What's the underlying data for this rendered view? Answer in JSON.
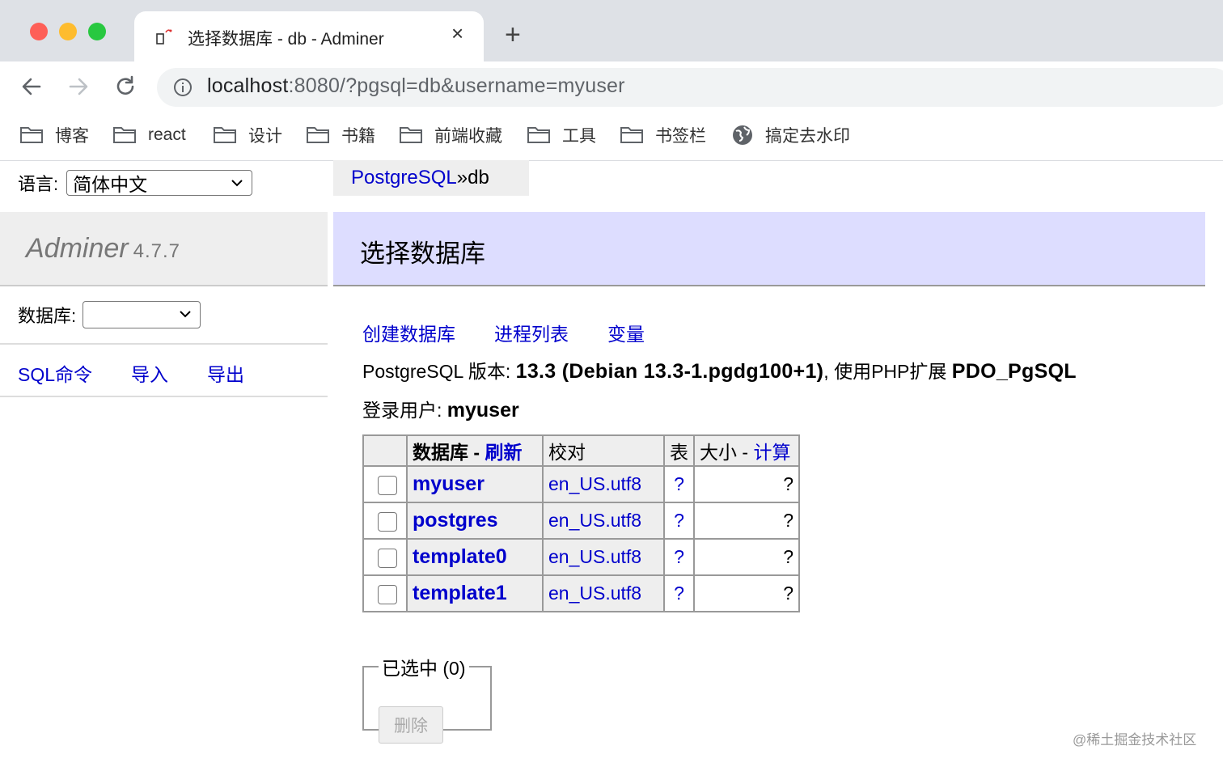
{
  "browser": {
    "tab_title": "选择数据库 - db - Adminer",
    "tab_close": "×",
    "new_tab": "+",
    "url_host": "localhost",
    "url_rest": ":8080/?pgsql=db&username=myuser",
    "bookmarks": [
      "博客",
      "react",
      "设计",
      "书籍",
      "前端收藏",
      "工具",
      "书签栏",
      "搞定去水印"
    ]
  },
  "sidebar": {
    "lang_label": "语言:",
    "lang_value": "简体中文",
    "brand": "Adminer",
    "version": "4.7.7",
    "db_label": "数据库:",
    "links": [
      "SQL命令",
      "导入",
      "导出"
    ]
  },
  "breadcrumb": {
    "link": "PostgreSQL",
    "sep": " » ",
    "current": "db"
  },
  "content": {
    "heading": "选择数据库",
    "links": [
      "创建数据库",
      "进程列表",
      "变量"
    ],
    "version_prefix": "PostgreSQL 版本:",
    "version_value": "13.3 (Debian 13.3-1.pgdg100+1)",
    "ext_prefix": ", 使用PHP扩展",
    "ext_value": "PDO_PgSQL",
    "login_prefix": "登录用户:",
    "login_value": "myuser",
    "table": {
      "h_db": "数据库",
      "h_dash": " - ",
      "h_refresh": "刷新",
      "h_collation": "校对",
      "h_tables": "表",
      "h_size": "大小",
      "h_size_dash": " - ",
      "h_compute": "计算",
      "rows": [
        {
          "name": "myuser",
          "collation": "en_US.utf8",
          "tables": "?",
          "size": "?"
        },
        {
          "name": "postgres",
          "collation": "en_US.utf8",
          "tables": "?",
          "size": "?"
        },
        {
          "name": "template0",
          "collation": "en_US.utf8",
          "tables": "?",
          "size": "?"
        },
        {
          "name": "template1",
          "collation": "en_US.utf8",
          "tables": "?",
          "size": "?"
        }
      ]
    },
    "selected_legend": "已选中 (0)",
    "delete_button": "删除"
  },
  "watermark": "@稀土掘金技术社区"
}
